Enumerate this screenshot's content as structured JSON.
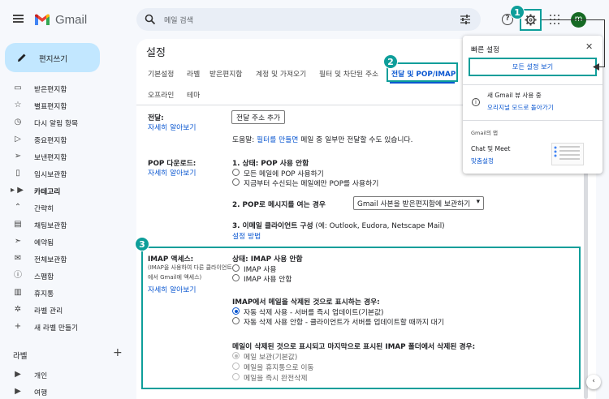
{
  "app": {
    "name": "Gmail",
    "avatar_initial": "m"
  },
  "search": {
    "placeholder": "메일 검색"
  },
  "steps": [
    "1",
    "2",
    "3"
  ],
  "sidebar": {
    "compose_label": "편지쓰기",
    "items": [
      {
        "label": "받은편지함",
        "icon": "inbox-icon"
      },
      {
        "label": "별표편지함",
        "icon": "star-icon"
      },
      {
        "label": "다시 알림 항목",
        "icon": "clock-icon"
      },
      {
        "label": "중요편지함",
        "icon": "important-icon"
      },
      {
        "label": "보낸편지함",
        "icon": "send-icon"
      },
      {
        "label": "임시보관함",
        "icon": "draft-icon"
      },
      {
        "label": "카테고리",
        "icon": "label-icon",
        "bold": true
      },
      {
        "label": "간략히",
        "icon": "chevron-up-icon"
      },
      {
        "label": "채팅보관함",
        "icon": "chat-icon"
      },
      {
        "label": "예약됨",
        "icon": "scheduled-icon"
      },
      {
        "label": "전체보관함",
        "icon": "all-mail-icon"
      },
      {
        "label": "스팸함",
        "icon": "spam-icon"
      },
      {
        "label": "휴지통",
        "icon": "trash-icon"
      },
      {
        "label": "라벨 관리",
        "icon": "settings-icon"
      },
      {
        "label": "새 라벨 만들기",
        "icon": "plus-icon"
      }
    ],
    "labels_heading": "라벨",
    "labels": [
      {
        "label": "개인",
        "icon": "label-icon"
      },
      {
        "label": "여행",
        "icon": "label-icon"
      }
    ]
  },
  "settings": {
    "title": "설정",
    "tabs_row1": [
      "기본설정",
      "라벨",
      "받은편지함",
      "계정 및 가져오기",
      "필터 및 차단된 주소",
      "전달 및 POP/IMAP"
    ],
    "tabs_row2": [
      "오프라인",
      "테마"
    ],
    "forwarding": {
      "label": "전달:",
      "learn_more": "자세히 알아보기",
      "add_button": "전달 주소 추가",
      "tip_prefix": "도움말: ",
      "tip_link": "필터를 만들면",
      "tip_suffix": " 메일 중 일부만 전달할 수도 있습니다."
    },
    "pop": {
      "label": "POP 다운로드:",
      "learn_more": "자세히 알아보기",
      "status": "1. 상태: POP 사용 안함",
      "opt1": "모든 메일에 POP 사용하기",
      "opt2": "지금부터 수신되는 메일에만 POP를 사용하기",
      "step2": "2. POP로 메시지를 여는 경우",
      "step2_select": "Gmail 사본을 받은편지함에 보관하기",
      "step3": "3. 이메일 클라이언트 구성",
      "step3_hint": " (예: Outlook, Eudora, Netscape Mail)",
      "setup_link": "설정 방법"
    },
    "imap": {
      "label": "IMAP 액세스:",
      "note": "(IMAP을 사용하여 다른 클라이언트에서 Gmail에 액세스)",
      "learn_more": "자세히 알아보기",
      "status": "상태: IMAP 사용 안함",
      "enable": "IMAP 사용",
      "disable": "IMAP 사용 안함",
      "deleted_heading": "IMAP에서 메일을 삭제된 것으로 표시하는 경우:",
      "auto_on": "자동 삭제 사용 - 서버를 즉시 업데이트(기본값)",
      "auto_off": "자동 삭제 사용 안함 - 클라이언트가 서버를 업데이트할 때까지 대기",
      "expunge_heading": "메일이 삭제된 것으로 표시되고 마지막으로 표시된 IMAP 폴더에서 삭제된 경우:",
      "archive": "메일 보관(기본값)",
      "trash": "메일을 휴지통으로 이동",
      "delete": "메일을 즉시 완전삭제"
    }
  },
  "quick_settings": {
    "title": "빠른 설정",
    "all_settings": "모든 설정 보기",
    "new_view": "새 Gmail 뷰 사용 중",
    "revert": "오리지널 모드로 돌아가기",
    "apps_heading": "Gmail의 앱",
    "chat_meet": "Chat 및 Meet",
    "customize": "맞춤설정"
  }
}
